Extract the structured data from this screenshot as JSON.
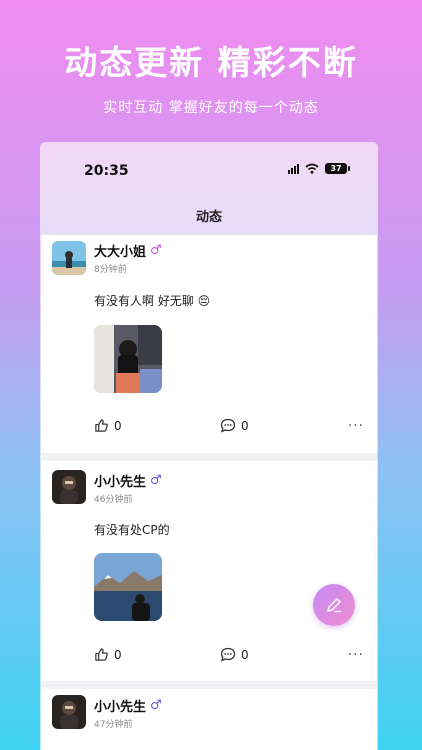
{
  "promo": {
    "title": "动态更新 精彩不断",
    "subtitle": "实时互动 掌握好友的每一个动态"
  },
  "status_bar": {
    "time": "20:35",
    "battery": "37"
  },
  "nav": {
    "title": "动态"
  },
  "posts": [
    {
      "name": "大大小姐",
      "gender_symbol": "♂",
      "gender_color": "#c24fe0",
      "time": "8分钟前",
      "content": "有没有人啊 好无聊 😔",
      "likes": "0",
      "comments": "0",
      "more": "···"
    },
    {
      "name": "小小先生",
      "gender_symbol": "♂",
      "gender_color": "#6a4fe0",
      "time": "46分钟前",
      "content": "有没有处CP的",
      "likes": "0",
      "comments": "0",
      "more": "···"
    },
    {
      "name": "小小先生",
      "gender_symbol": "♂",
      "gender_color": "#6a4fe0",
      "time": "47分钟前"
    }
  ],
  "icons": {
    "like": "thumbs-up-icon",
    "comment": "comment-icon",
    "more": "more-icon",
    "compose": "pencil-icon"
  }
}
